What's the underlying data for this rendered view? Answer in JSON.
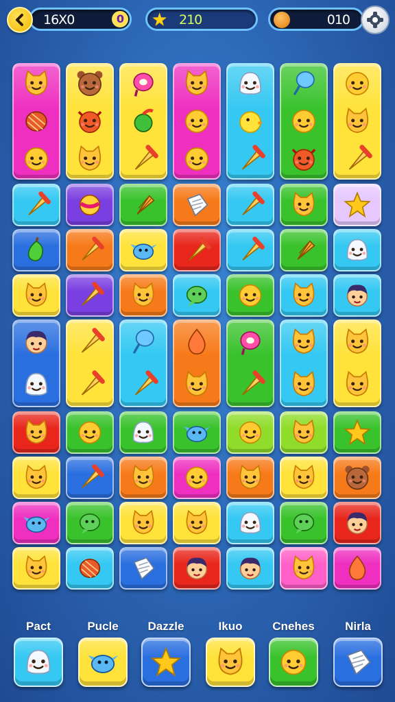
{
  "hud": {
    "moves": "16X0",
    "moves_badge": "0",
    "stars": "210",
    "coins": "010"
  },
  "colors": {
    "magenta": "#ee2fc0",
    "yellow": "#ffe23a",
    "cyan": "#34c8f2",
    "green": "#39c22c",
    "orange": "#f77a1a",
    "purple": "#7a3fe0",
    "red": "#e8261c",
    "blue": "#2a6fe0",
    "pink": "#ff5fc8",
    "lilac": "#e6c8ff",
    "lime": "#8fdc2a"
  },
  "board": {
    "columns": 7,
    "tiles": [
      {
        "col": 0,
        "row": 0,
        "span": 3,
        "color": "magenta",
        "icons": [
          "cat",
          "yarn",
          "blob"
        ]
      },
      {
        "col": 1,
        "row": 0,
        "span": 3,
        "color": "yellow",
        "icons": [
          "bear",
          "devil",
          "cat"
        ]
      },
      {
        "col": 2,
        "row": 0,
        "span": 3,
        "color": "yellow",
        "icons": [
          "ring",
          "apple",
          "cone"
        ]
      },
      {
        "col": 3,
        "row": 0,
        "span": 3,
        "color": "magenta",
        "icons": [
          "cat",
          "blob",
          "blob"
        ]
      },
      {
        "col": 4,
        "row": 0,
        "span": 3,
        "color": "cyan",
        "icons": [
          "ghost",
          "chick",
          "cone"
        ]
      },
      {
        "col": 5,
        "row": 0,
        "span": 3,
        "color": "green",
        "icons": [
          "balloon",
          "blob",
          "devil"
        ]
      },
      {
        "col": 6,
        "row": 0,
        "span": 3,
        "color": "yellow",
        "icons": [
          "blob",
          "cat",
          "cone"
        ]
      },
      {
        "col": 0,
        "row": 3,
        "span": 1,
        "color": "cyan",
        "icons": [
          "cone"
        ]
      },
      {
        "col": 1,
        "row": 3,
        "span": 1,
        "color": "purple",
        "icons": [
          "ball"
        ]
      },
      {
        "col": 2,
        "row": 3,
        "span": 1,
        "color": "green",
        "icons": [
          "corn"
        ]
      },
      {
        "col": 3,
        "row": 3,
        "span": 1,
        "color": "orange",
        "icons": [
          "paper"
        ]
      },
      {
        "col": 4,
        "row": 3,
        "span": 1,
        "color": "cyan",
        "icons": [
          "cone"
        ]
      },
      {
        "col": 5,
        "row": 3,
        "span": 1,
        "color": "green",
        "icons": [
          "cat"
        ]
      },
      {
        "col": 6,
        "row": 3,
        "span": 1,
        "color": "lilac",
        "icons": [
          "star"
        ]
      },
      {
        "col": 0,
        "row": 4,
        "span": 1,
        "color": "blue",
        "icons": [
          "pear"
        ]
      },
      {
        "col": 1,
        "row": 4,
        "span": 1,
        "color": "orange",
        "icons": [
          "cone"
        ]
      },
      {
        "col": 2,
        "row": 4,
        "span": 1,
        "color": "yellow",
        "icons": [
          "bird"
        ]
      },
      {
        "col": 3,
        "row": 4,
        "span": 1,
        "color": "red",
        "icons": [
          "cone"
        ]
      },
      {
        "col": 4,
        "row": 4,
        "span": 1,
        "color": "cyan",
        "icons": [
          "cone"
        ]
      },
      {
        "col": 5,
        "row": 4,
        "span": 1,
        "color": "green",
        "icons": [
          "corn"
        ]
      },
      {
        "col": 6,
        "row": 4,
        "span": 1,
        "color": "cyan",
        "icons": [
          "ghost"
        ]
      },
      {
        "col": 0,
        "row": 5,
        "span": 1,
        "color": "yellow",
        "icons": [
          "cat"
        ]
      },
      {
        "col": 1,
        "row": 5,
        "span": 1,
        "color": "purple",
        "icons": [
          "cone"
        ]
      },
      {
        "col": 2,
        "row": 5,
        "span": 1,
        "color": "orange",
        "icons": [
          "cat"
        ]
      },
      {
        "col": 3,
        "row": 5,
        "span": 1,
        "color": "cyan",
        "icons": [
          "bubble"
        ]
      },
      {
        "col": 4,
        "row": 5,
        "span": 1,
        "color": "green",
        "icons": [
          "blob"
        ]
      },
      {
        "col": 5,
        "row": 5,
        "span": 1,
        "color": "cyan",
        "icons": [
          "cat"
        ]
      },
      {
        "col": 6,
        "row": 5,
        "span": 1,
        "color": "cyan",
        "icons": [
          "face"
        ]
      },
      {
        "col": 0,
        "row": 6,
        "span": 2,
        "color": "blue",
        "icons": [
          "face",
          "ghost"
        ]
      },
      {
        "col": 1,
        "row": 6,
        "span": 2,
        "color": "yellow",
        "icons": [
          "cone",
          "cone"
        ]
      },
      {
        "col": 2,
        "row": 6,
        "span": 2,
        "color": "cyan",
        "icons": [
          "balloon",
          "cone"
        ]
      },
      {
        "col": 3,
        "row": 6,
        "span": 2,
        "color": "orange",
        "icons": [
          "drop",
          "cat"
        ]
      },
      {
        "col": 4,
        "row": 6,
        "span": 2,
        "color": "green",
        "icons": [
          "ring",
          "cone"
        ]
      },
      {
        "col": 5,
        "row": 6,
        "span": 2,
        "color": "cyan",
        "icons": [
          "cat",
          "cat"
        ]
      },
      {
        "col": 6,
        "row": 6,
        "span": 2,
        "color": "yellow",
        "icons": [
          "cat",
          "cat"
        ]
      },
      {
        "col": 0,
        "row": 8,
        "span": 1,
        "color": "red",
        "icons": [
          "cat"
        ]
      },
      {
        "col": 1,
        "row": 8,
        "span": 1,
        "color": "green",
        "icons": [
          "blob"
        ]
      },
      {
        "col": 2,
        "row": 8,
        "span": 1,
        "color": "green",
        "icons": [
          "ghost"
        ]
      },
      {
        "col": 3,
        "row": 8,
        "span": 1,
        "color": "green",
        "icons": [
          "bird"
        ]
      },
      {
        "col": 4,
        "row": 8,
        "span": 1,
        "color": "lime",
        "icons": [
          "blob"
        ]
      },
      {
        "col": 5,
        "row": 8,
        "span": 1,
        "color": "lime",
        "icons": [
          "cat"
        ]
      },
      {
        "col": 6,
        "row": 8,
        "span": 1,
        "color": "green",
        "icons": [
          "star"
        ]
      },
      {
        "col": 0,
        "row": 9,
        "span": 1,
        "color": "yellow",
        "icons": [
          "cat"
        ]
      },
      {
        "col": 1,
        "row": 9,
        "span": 1,
        "color": "blue",
        "icons": [
          "cone"
        ]
      },
      {
        "col": 2,
        "row": 9,
        "span": 1,
        "color": "orange",
        "icons": [
          "cat"
        ]
      },
      {
        "col": 3,
        "row": 9,
        "span": 1,
        "color": "magenta",
        "icons": [
          "blob"
        ]
      },
      {
        "col": 4,
        "row": 9,
        "span": 1,
        "color": "orange",
        "icons": [
          "cat"
        ]
      },
      {
        "col": 5,
        "row": 9,
        "span": 1,
        "color": "yellow",
        "icons": [
          "cat"
        ]
      },
      {
        "col": 6,
        "row": 9,
        "span": 1,
        "color": "orange",
        "icons": [
          "bear"
        ]
      },
      {
        "col": 0,
        "row": 10,
        "span": 1,
        "color": "magenta",
        "icons": [
          "bird"
        ]
      },
      {
        "col": 1,
        "row": 10,
        "span": 1,
        "color": "green",
        "icons": [
          "bubble"
        ]
      },
      {
        "col": 2,
        "row": 10,
        "span": 1,
        "color": "yellow",
        "icons": [
          "cat"
        ]
      },
      {
        "col": 3,
        "row": 10,
        "span": 1,
        "color": "yellow",
        "icons": [
          "cat"
        ]
      },
      {
        "col": 4,
        "row": 10,
        "span": 1,
        "color": "cyan",
        "icons": [
          "ghost"
        ]
      },
      {
        "col": 5,
        "row": 10,
        "span": 1,
        "color": "green",
        "icons": [
          "bubble"
        ]
      },
      {
        "col": 6,
        "row": 10,
        "span": 1,
        "color": "red",
        "icons": [
          "face"
        ]
      },
      {
        "col": 0,
        "row": 11,
        "span": 1,
        "color": "yellow",
        "icons": [
          "cat"
        ]
      },
      {
        "col": 1,
        "row": 11,
        "span": 1,
        "color": "cyan",
        "icons": [
          "yarn"
        ]
      },
      {
        "col": 2,
        "row": 11,
        "span": 1,
        "color": "blue",
        "icons": [
          "paper"
        ]
      },
      {
        "col": 3,
        "row": 11,
        "span": 1,
        "color": "red",
        "icons": [
          "face"
        ]
      },
      {
        "col": 4,
        "row": 11,
        "span": 1,
        "color": "cyan",
        "icons": [
          "face"
        ]
      },
      {
        "col": 5,
        "row": 11,
        "span": 1,
        "color": "pink",
        "icons": [
          "cat"
        ]
      },
      {
        "col": 6,
        "row": 11,
        "span": 1,
        "color": "magenta",
        "icons": [
          "drop"
        ]
      }
    ]
  },
  "tray": [
    {
      "label": "Pact",
      "color": "cyan",
      "icon": "ghost"
    },
    {
      "label": "Pucle",
      "color": "yellow",
      "icon": "bird"
    },
    {
      "label": "Dazzle",
      "color": "blue",
      "icon": "star"
    },
    {
      "label": "Ikuo",
      "color": "yellow",
      "icon": "cat"
    },
    {
      "label": "Cnehes",
      "color": "green",
      "icon": "blob"
    },
    {
      "label": "Nirla",
      "color": "blue",
      "icon": "paper"
    }
  ]
}
